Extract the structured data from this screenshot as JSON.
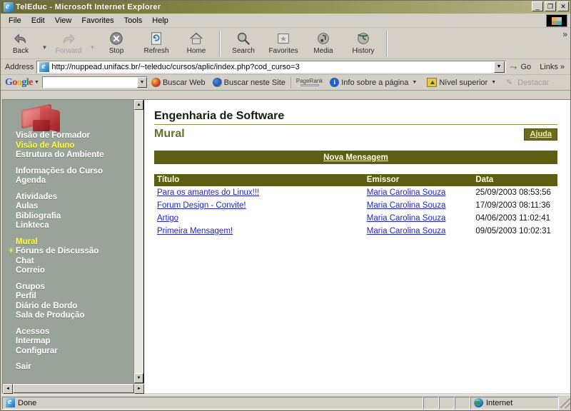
{
  "window": {
    "title": "TelEduc - Microsoft Internet Explorer",
    "icon": "ie-icon",
    "minimize_label": "_",
    "restore_label": "❐",
    "close_label": "✕"
  },
  "menu": {
    "items": [
      {
        "label": "File"
      },
      {
        "label": "Edit"
      },
      {
        "label": "View"
      },
      {
        "label": "Favorites"
      },
      {
        "label": "Tools"
      },
      {
        "label": "Help"
      }
    ]
  },
  "toolbar": {
    "buttons": [
      {
        "label": "Back",
        "icon": "back-arrow-icon",
        "disabled": false,
        "has_arrow": true
      },
      {
        "label": "Forward",
        "icon": "forward-arrow-icon",
        "disabled": true,
        "has_arrow": true
      },
      {
        "label": "Stop",
        "icon": "stop-icon",
        "disabled": false
      },
      {
        "label": "Refresh",
        "icon": "refresh-icon",
        "disabled": false
      },
      {
        "label": "Home",
        "icon": "home-icon",
        "disabled": false
      },
      {
        "label": "Search",
        "icon": "search-icon",
        "disabled": false
      },
      {
        "label": "Favorites",
        "icon": "favorites-star-icon",
        "disabled": false
      },
      {
        "label": "Media",
        "icon": "media-note-icon",
        "disabled": false
      },
      {
        "label": "History",
        "icon": "history-clock-icon",
        "disabled": false
      }
    ],
    "overflow_label": "»"
  },
  "address": {
    "label": "Address",
    "url": "http://nuppead.unifacs.br/~teleduc/cursos/aplic/index.php?cod_curso=3",
    "go_label": "Go",
    "links_label": "Links",
    "links_overflow": "»",
    "dropdown_glyph": "▼"
  },
  "google_toolbar": {
    "logo": [
      {
        "ch": "G",
        "cls": "b"
      },
      {
        "ch": "o",
        "cls": "r"
      },
      {
        "ch": "o",
        "cls": "y"
      },
      {
        "ch": "g",
        "cls": "b"
      },
      {
        "ch": "l",
        "cls": "g"
      },
      {
        "ch": "e",
        "cls": "r"
      }
    ],
    "search_value": "",
    "search_placeholder": "",
    "items": [
      {
        "label": "Buscar Web",
        "icon": "search-web-icon",
        "disabled": false
      },
      {
        "label": "Buscar neste Site",
        "icon": "search-site-icon",
        "disabled": false
      },
      {
        "label": "PageRank",
        "icon": "pagerank-icon",
        "disabled": false
      },
      {
        "label": "Info sobre a página",
        "icon": "info-icon",
        "disabled": false,
        "caret": "▼"
      },
      {
        "label": "Nível superior",
        "icon": "up-level-icon",
        "disabled": false,
        "caret": "▼"
      },
      {
        "label": "Destacar",
        "icon": "highlight-icon",
        "disabled": true
      }
    ]
  },
  "sidebar": {
    "logo_alt": "teleduc-logo",
    "groups": [
      {
        "items": [
          {
            "label": "Visão de Formador",
            "active": false,
            "marker": false
          },
          {
            "label": "Visão de Aluno",
            "active": true,
            "marker": false
          },
          {
            "label": "Estrutura do Ambiente",
            "active": false,
            "marker": false
          }
        ]
      },
      {
        "items": [
          {
            "label": "Informações do Curso",
            "active": false,
            "marker": false
          },
          {
            "label": "Agenda",
            "active": false,
            "marker": false
          }
        ]
      },
      {
        "items": [
          {
            "label": "Atividades",
            "active": false,
            "marker": false
          },
          {
            "label": "Aulas",
            "active": false,
            "marker": false
          },
          {
            "label": "Bibliografia",
            "active": false,
            "marker": false
          },
          {
            "label": "Linkteca",
            "active": false,
            "marker": false
          }
        ]
      },
      {
        "items": [
          {
            "label": "Mural",
            "active": true,
            "marker": false
          },
          {
            "label": "Fóruns de Discussão",
            "active": false,
            "marker": true
          },
          {
            "label": "Chat",
            "active": false,
            "marker": false
          },
          {
            "label": "Correio",
            "active": false,
            "marker": false
          }
        ]
      },
      {
        "items": [
          {
            "label": "Grupos",
            "active": false,
            "marker": false
          },
          {
            "label": "Perfil",
            "active": false,
            "marker": false
          },
          {
            "label": "Diário de Bordo",
            "active": false,
            "marker": false
          },
          {
            "label": "Sala de Produção",
            "active": false,
            "marker": false
          }
        ]
      },
      {
        "items": [
          {
            "label": "Acessos",
            "active": false,
            "marker": false
          },
          {
            "label": "Intermap",
            "active": false,
            "marker": false
          },
          {
            "label": "Configurar",
            "active": false,
            "marker": false
          }
        ]
      },
      {
        "items": [
          {
            "label": "Sair",
            "active": false,
            "marker": false
          }
        ]
      }
    ],
    "scroll_up_glyph": "▲",
    "scroll_down_glyph": "▼",
    "scroll_left_glyph": "◄",
    "scroll_right_glyph": "►"
  },
  "content": {
    "course_title": "Engenharia de Software",
    "tool_title": "Mural",
    "help_label": "Ajuda",
    "new_message_label": "Nova Mensagem",
    "table": {
      "headers": [
        "Título",
        "Emissor",
        "Data"
      ],
      "rows": [
        {
          "titulo": "Para os amantes do Linux!!!",
          "emissor": "Maria Carolina Souza",
          "data": "25/09/2003 08:53:56"
        },
        {
          "titulo": "Forum Design - Convite!",
          "emissor": "Maria Carolina Souza",
          "data": "17/09/2003 08:11:36"
        },
        {
          "titulo": "Artigo",
          "emissor": "Maria Carolina Souza",
          "data": "04/06/2003 11:02:41"
        },
        {
          "titulo": "Primeira Mensagem!",
          "emissor": "Maria Carolina Souza",
          "data": "09/05/2003 10:02:31"
        }
      ]
    }
  },
  "statusbar": {
    "status_text": "Done",
    "zone_text": "Internet",
    "zone_icon": "globe-icon",
    "page_icon": "ie-icon"
  },
  "colors": {
    "titlebar_accent": "#6b6b33",
    "olive_bar": "#5d5d14",
    "sidebar_bg": "#9aa39a",
    "active_link": "#ffff33",
    "table_link": "#2222cc",
    "chrome_bg": "#d4d0c8"
  }
}
